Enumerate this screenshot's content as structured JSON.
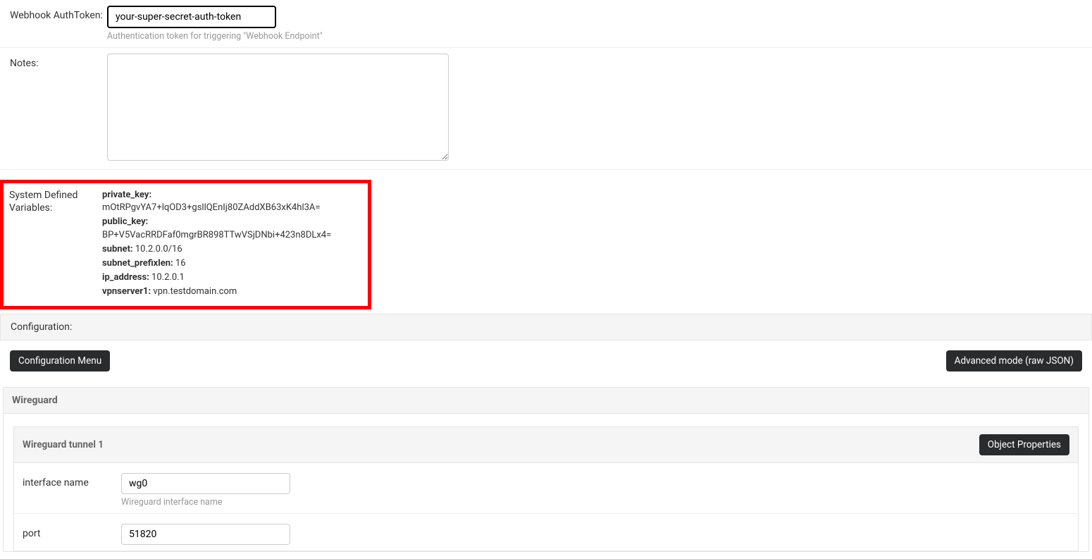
{
  "webhook": {
    "label": "Webhook AuthToken:",
    "value": "your-super-secret-auth-token",
    "help": "Authentication token for triggering \"Webhook Endpoint\""
  },
  "notes": {
    "label": "Notes:",
    "value": ""
  },
  "sysvars": {
    "label": "System Defined Variables:",
    "items": [
      {
        "k": "private_key:",
        "v": "mOtRPgvYA7+lqOD3+gsllQEnIj80ZAddXB63xK4hl3A="
      },
      {
        "k": "public_key:",
        "v": "BP+V5VacRRDFaf0mgrBR898TTwVSjDNbi+423n8DLx4="
      },
      {
        "k": "subnet:",
        "v": "10.2.0.0/16"
      },
      {
        "k": "subnet_prefixlen:",
        "v": "16"
      },
      {
        "k": "ip_address:",
        "v": "10.2.0.1"
      },
      {
        "k": "vpnserver1:",
        "v": "vpn.testdomain.com"
      }
    ]
  },
  "configuration_header": "Configuration:",
  "buttons": {
    "config_menu": "Configuration Menu",
    "advanced": "Advanced mode (raw JSON)",
    "object_props": "Object Properties"
  },
  "wireguard": {
    "title": "Wireguard",
    "tunnel_title": "Wireguard tunnel 1",
    "interface": {
      "label": "interface name",
      "value": "wg0",
      "help": "Wireguard interface name"
    },
    "port": {
      "label": "port",
      "value": "51820"
    }
  }
}
